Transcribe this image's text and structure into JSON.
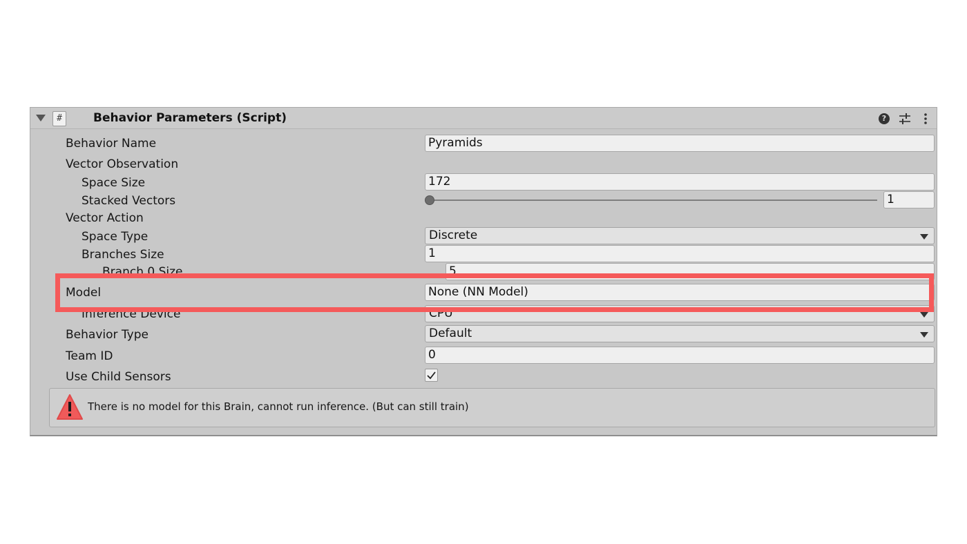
{
  "component": {
    "title": "Behavior Parameters (Script)",
    "script_icon_glyph": "#",
    "header_icons": [
      "help-icon",
      "presets-icon",
      "kebab-menu-icon"
    ]
  },
  "fields": {
    "behavior_name": {
      "label": "Behavior Name",
      "value": "Pyramids"
    },
    "vector_observation": {
      "label": "Vector Observation"
    },
    "space_size": {
      "label": "Space Size",
      "value": "172"
    },
    "stacked_vectors": {
      "label": "Stacked Vectors",
      "value": "1"
    },
    "vector_action": {
      "label": "Vector Action"
    },
    "space_type": {
      "label": "Space Type",
      "value": "Discrete"
    },
    "branches_size": {
      "label": "Branches Size",
      "value": "1"
    },
    "branch_0_size": {
      "label": "Branch 0 Size",
      "value": "5"
    },
    "model": {
      "label": "Model",
      "value": "None (NN Model)"
    },
    "inference_device": {
      "label": "Inference Device",
      "value": "CPU"
    },
    "behavior_type": {
      "label": "Behavior Type",
      "value": "Default"
    },
    "team_id": {
      "label": "Team ID",
      "value": "0"
    },
    "use_child_sensors": {
      "label": "Use Child Sensors",
      "checked": true
    }
  },
  "warning": {
    "text": "There is no model for this Brain, cannot run inference. (But can still train)",
    "icon": "warning-icon",
    "icon_color": "#f05a5a"
  },
  "highlight_color": "#f55a5a"
}
